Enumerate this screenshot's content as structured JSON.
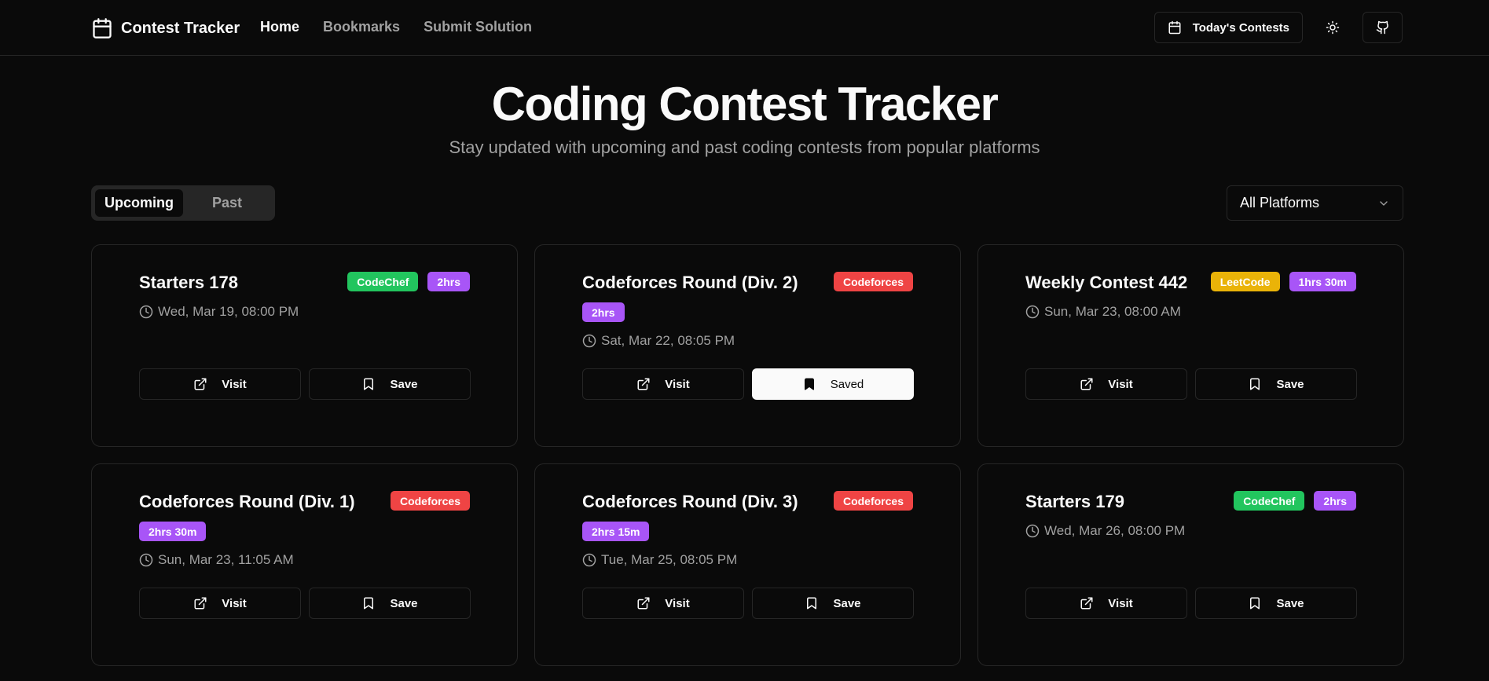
{
  "nav": {
    "brand": "Contest Tracker",
    "links": [
      {
        "label": "Home",
        "active": true
      },
      {
        "label": "Bookmarks",
        "active": false
      },
      {
        "label": "Submit Solution",
        "active": false
      }
    ],
    "todays_contests_label": "Today's Contests",
    "icons": [
      "calendar-icon",
      "sun-icon",
      "github-icon"
    ]
  },
  "hero": {
    "title": "Coding Contest Tracker",
    "subtitle": "Stay updated with upcoming and past coding contests from popular platforms"
  },
  "tabs": [
    {
      "label": "Upcoming",
      "active": true
    },
    {
      "label": "Past",
      "active": false
    }
  ],
  "filter": {
    "selected": "All Platforms"
  },
  "colors": {
    "CodeChef": "#22c55e",
    "Codeforces": "#ef4444",
    "LeetCode": "#eab308",
    "duration": "#a855f7"
  },
  "contests": [
    {
      "title": "Starters 178",
      "platform": "CodeChef",
      "duration": "2hrs",
      "date": "Wed, Mar 19, 08:00 PM",
      "visit_label": "Visit",
      "save_label": "Save",
      "saved": false,
      "wrap": false
    },
    {
      "title": "Codeforces Round (Div. 2)",
      "platform": "Codeforces",
      "duration": "2hrs",
      "date": "Sat, Mar 22, 08:05 PM",
      "visit_label": "Visit",
      "save_label": "Saved",
      "saved": true,
      "wrap": true
    },
    {
      "title": "Weekly Contest 442",
      "platform": "LeetCode",
      "duration": "1hrs 30m",
      "date": "Sun, Mar 23, 08:00 AM",
      "visit_label": "Visit",
      "save_label": "Save",
      "saved": false,
      "wrap": false
    },
    {
      "title": "Codeforces Round (Div. 1)",
      "platform": "Codeforces",
      "duration": "2hrs 30m",
      "date": "Sun, Mar 23, 11:05 AM",
      "visit_label": "Visit",
      "save_label": "Save",
      "saved": false,
      "wrap": true
    },
    {
      "title": "Codeforces Round (Div. 3)",
      "platform": "Codeforces",
      "duration": "2hrs 15m",
      "date": "Tue, Mar 25, 08:05 PM",
      "visit_label": "Visit",
      "save_label": "Save",
      "saved": false,
      "wrap": true
    },
    {
      "title": "Starters 179",
      "platform": "CodeChef",
      "duration": "2hrs",
      "date": "Wed, Mar 26, 08:00 PM",
      "visit_label": "Visit",
      "save_label": "Save",
      "saved": false,
      "wrap": false
    }
  ]
}
